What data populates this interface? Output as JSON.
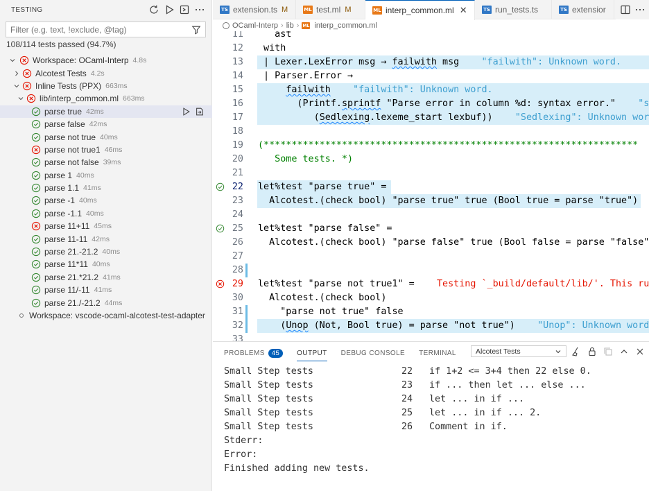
{
  "sidebar": {
    "title": "TESTING",
    "filter_placeholder": "Filter (e.g. text, !exclude, @tag)",
    "summary": "108/114 tests passed (94.7%)",
    "workspace1": {
      "label": "Workspace: OCaml-Interp",
      "duration": "4.8s"
    },
    "alcotest": {
      "label": "Alcotest Tests",
      "duration": "4.2s"
    },
    "inline": {
      "label": "Inline Tests (PPX)",
      "duration": "663ms"
    },
    "file": {
      "label": "lib/interp_common.ml",
      "duration": "663ms"
    },
    "tests": [
      {
        "label": "parse true",
        "duration": "42ms",
        "status": "pass"
      },
      {
        "label": "parse false",
        "duration": "42ms",
        "status": "pass"
      },
      {
        "label": "parse not true",
        "duration": "40ms",
        "status": "pass"
      },
      {
        "label": "parse not true1",
        "duration": "46ms",
        "status": "fail"
      },
      {
        "label": "parse not false",
        "duration": "39ms",
        "status": "pass"
      },
      {
        "label": "parse 1",
        "duration": "40ms",
        "status": "pass"
      },
      {
        "label": "parse 1.1",
        "duration": "41ms",
        "status": "pass"
      },
      {
        "label": "parse -1",
        "duration": "40ms",
        "status": "pass"
      },
      {
        "label": "parse -1.1",
        "duration": "40ms",
        "status": "pass"
      },
      {
        "label": "parse 11+11",
        "duration": "45ms",
        "status": "fail"
      },
      {
        "label": "parse 11-11",
        "duration": "42ms",
        "status": "pass"
      },
      {
        "label": "parse 21.-21.2",
        "duration": "40ms",
        "status": "pass"
      },
      {
        "label": "parse 11*11",
        "duration": "40ms",
        "status": "pass"
      },
      {
        "label": "parse 21.*21.2",
        "duration": "41ms",
        "status": "pass"
      },
      {
        "label": "parse 11/-11",
        "duration": "41ms",
        "status": "pass"
      },
      {
        "label": "parse 21./-21.2",
        "duration": "44ms",
        "status": "pass"
      }
    ],
    "workspace2": {
      "label": "Workspace: vscode-ocaml-alcotest-test-adapter"
    }
  },
  "tabs": [
    {
      "label": "extension.ts",
      "icon": "ts",
      "badge": "M"
    },
    {
      "label": "test.ml",
      "icon": "ml",
      "badge": "M"
    },
    {
      "label": "interp_common.ml",
      "icon": "ml",
      "badge": ""
    },
    {
      "label": "run_tests.ts",
      "icon": "ts",
      "badge": ""
    },
    {
      "label": "extensior",
      "icon": "ts",
      "badge": ""
    }
  ],
  "breadcrumb": {
    "root": "OCaml-Interp",
    "dir": "lib",
    "file": "interp_common.ml"
  },
  "editor": {
    "lines": [
      {
        "n": "11",
        "code": "   ast"
      },
      {
        "n": "12",
        "code": " with"
      },
      {
        "n": "13",
        "code": " | Lexer.LexError msg → ",
        "squig": "failwith",
        "rest": " msg",
        "msg": "\"failwith\": Unknown word."
      },
      {
        "n": "14",
        "code": " | Parser.Error →"
      },
      {
        "n": "15",
        "code": "     ",
        "squig": "failwith",
        "rest": "",
        "msg": "\"failwith\": Unknown word."
      },
      {
        "n": "16",
        "code": "       (Printf.",
        "squig": "sprintf",
        "rest": " \"Parse error in column %d: syntax error.\"",
        "msg": "\"s"
      },
      {
        "n": "17",
        "code": "          (",
        "squig": "Sedlexing",
        "rest": ".lexeme_start lexbuf))",
        "msg": "\"Sedlexing\": Unknown wor"
      },
      {
        "n": "18",
        "code": ""
      },
      {
        "n": "19",
        "code": "(*******************************************************************"
      },
      {
        "n": "20",
        "code": "   Some tests. *)"
      },
      {
        "n": "21",
        "code": ""
      },
      {
        "n": "22",
        "code": "let%test \"parse true\" ="
      },
      {
        "n": "23",
        "code": "  Alcotest.(check bool) \"parse true\" true (Bool true = parse \"true\")"
      },
      {
        "n": "24",
        "code": ""
      },
      {
        "n": "25",
        "code": "let%test \"parse false\" ="
      },
      {
        "n": "26",
        "code": "  Alcotest.(check bool) \"parse false\" true (Bool false = parse \"false\")"
      },
      {
        "n": "27",
        "code": ""
      },
      {
        "n": "28",
        "code": ""
      },
      {
        "n": "29",
        "code": "let%test \"parse not true1\" =",
        "err": "Testing `_build/default/lib/'. This run"
      },
      {
        "n": "30",
        "code": "  Alcotest.(check bool)"
      },
      {
        "n": "31",
        "code": "    \"parse not true\" false"
      },
      {
        "n": "32",
        "code": "    (",
        "squig": "Unop",
        "rest": " (Not, Bool true) = parse \"not true\")",
        "msg": "\"Unop\": Unknown word."
      },
      {
        "n": "33",
        "code": ""
      }
    ]
  },
  "panel": {
    "tabs": {
      "problems": "PROBLEMS",
      "problems_count": "45",
      "output": "OUTPUT",
      "debug": "DEBUG CONSOLE",
      "terminal": "TERMINAL"
    },
    "channel": "Alcotest Tests",
    "output": [
      {
        "a": "Small Step tests",
        "b": "22",
        "c": "if 1+2 <= 3+4 then 22 else 0."
      },
      {
        "a": "Small Step tests",
        "b": "23",
        "c": "if ... then let ... else ..."
      },
      {
        "a": "Small Step tests",
        "b": "24",
        "c": "let ... in if ..."
      },
      {
        "a": "Small Step tests",
        "b": "25",
        "c": "let ... in if ... 2."
      },
      {
        "a": "Small Step tests",
        "b": "26",
        "c": "Comment in if."
      }
    ],
    "tail": [
      "Stderr:",
      "Error:",
      "Finished adding new tests."
    ]
  },
  "colors": {
    "accent": "#005fb8",
    "pass": "#388a34",
    "fail": "#e51400",
    "highlight": "#d7eef9"
  }
}
